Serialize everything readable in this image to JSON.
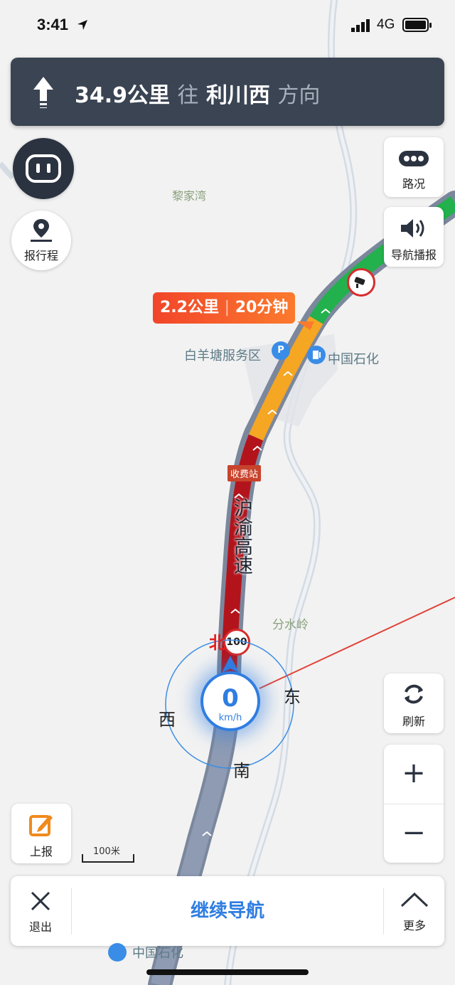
{
  "status_bar": {
    "time": "3:41",
    "network": "4G"
  },
  "nav_banner": {
    "distance": "34.9公里",
    "toward": "往",
    "destination": "利川西",
    "direction": "方向"
  },
  "route_bubble": {
    "distance": "2.2公里",
    "time": "20分钟"
  },
  "buttons": {
    "report_trip": "报行程",
    "traffic": "路况",
    "voice": "导航播报",
    "refresh": "刷新",
    "zoom_in": "+",
    "zoom_out": "−",
    "report": "上报",
    "exit": "退出",
    "continue_nav": "继续导航",
    "more": "更多"
  },
  "map_labels": {
    "village1": "黎家湾",
    "service_area": "白羊塘服务区",
    "gas_station": "中国石化",
    "toll": "收费站",
    "highway": "沪渝高速",
    "village2": "分水岭",
    "gas_station_bottom": "中国石化",
    "speed_limit": "100",
    "scale": "100米"
  },
  "compass": {
    "north": "北",
    "east": "东",
    "south": "南",
    "west": "西"
  },
  "speedometer": {
    "value": "0",
    "unit": "km/h"
  },
  "colors": {
    "banner": "#3a4453",
    "accent": "#2f7de1",
    "traffic_green": "#22b14c",
    "traffic_orange": "#f5a623",
    "traffic_red": "#b3141c"
  }
}
